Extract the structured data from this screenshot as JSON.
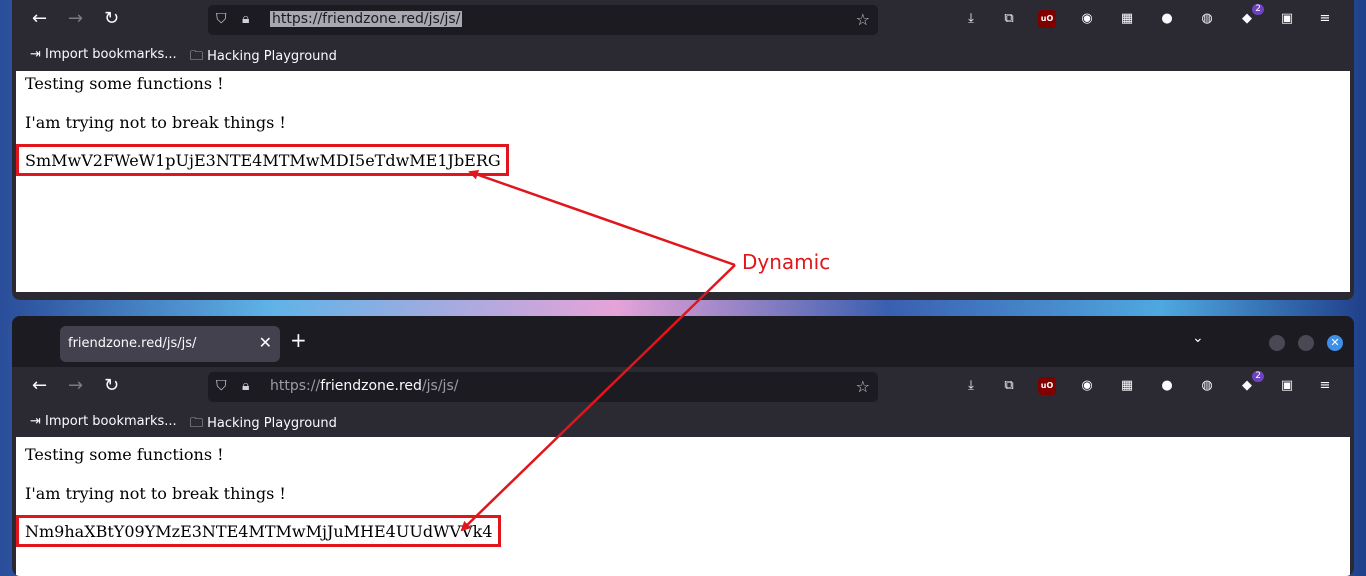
{
  "browser": {
    "url_top": "https://friendzone.red/js/js/",
    "url_bottom_scheme": "https://",
    "url_bottom_host": "friendzone.red",
    "url_bottom_path": "/js/js/",
    "tab_title": "friendzone.red/js/js/",
    "tab_close": "✕",
    "new_tab": "+",
    "extension_badge": "2"
  },
  "bookmarks": {
    "import": "Import bookmarks...",
    "folder": "Hacking Playground"
  },
  "page": {
    "line1": "Testing some functions !",
    "line2": "I'am trying not to break things !"
  },
  "tokens": {
    "top": "SmMwV2FWeW1pUjE3NTE4MTMwMDI5eTdwME1JbERG",
    "bottom": "Nm9haXBtY09YMzE3NTE4MTMwMjJuMHE4UUdWVVk4"
  },
  "annotation": {
    "label": "Dynamic",
    "color": "#e0161c"
  }
}
